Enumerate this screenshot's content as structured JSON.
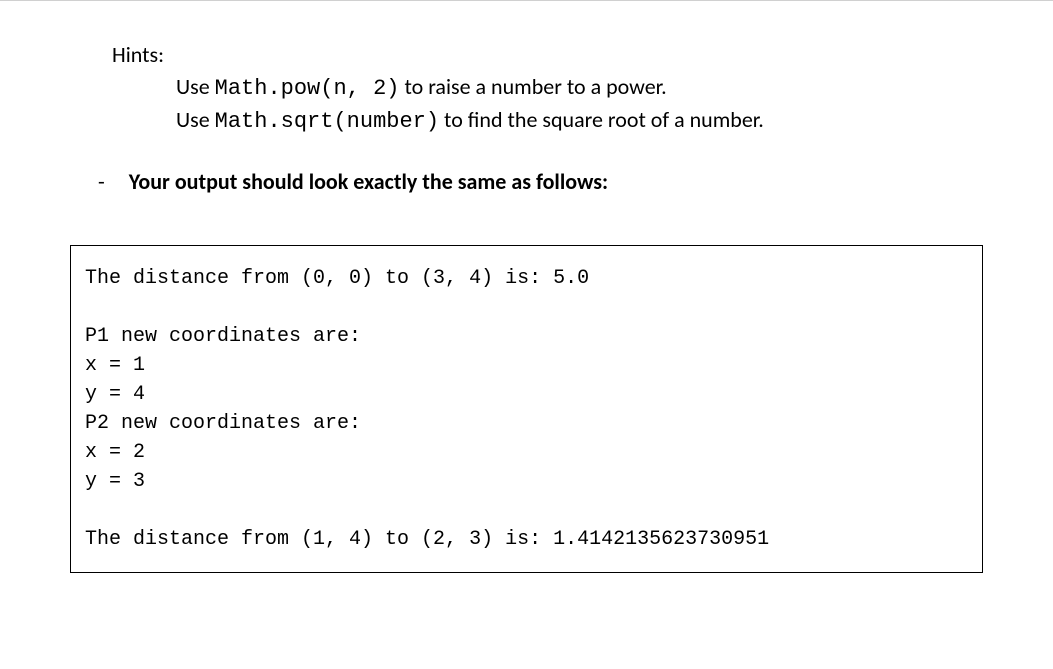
{
  "hints": {
    "title": "Hints:",
    "line1_prefix": "Use ",
    "line1_code": "Math.pow(n, 2)",
    "line1_suffix": " to raise a number to a power.",
    "line2_prefix": "Use ",
    "line2_code": "Math.sqrt(number)",
    "line2_suffix": " to find the square root of a number."
  },
  "bullet": {
    "dash": "-",
    "text": "Your output should look exactly the same as follows:"
  },
  "output": {
    "line1": "The distance from (0, 0) to (3, 4) is: 5.0",
    "blank1": "",
    "line2": "P1 new coordinates are:",
    "line3": "x = 1",
    "line4": "y = 4",
    "line5": "P2 new coordinates are:",
    "line6": "x = 2",
    "line7": "y = 3",
    "blank2": "",
    "line8": "The distance from (1, 4) to (2, 3) is: 1.4142135623730951"
  }
}
